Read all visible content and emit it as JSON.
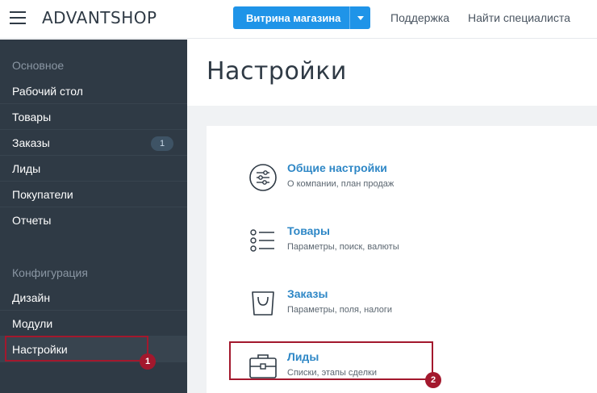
{
  "header": {
    "logo": "ADVANTSHOP",
    "store_button": "Витрина магазина",
    "links": [
      "Поддержка",
      "Найти специалиста"
    ]
  },
  "sidebar": {
    "section_main": "Основное",
    "main_items": [
      {
        "label": "Рабочий стол"
      },
      {
        "label": "Товары"
      },
      {
        "label": "Заказы",
        "badge": "1"
      },
      {
        "label": "Лиды"
      },
      {
        "label": "Покупатели"
      },
      {
        "label": "Отчеты"
      }
    ],
    "section_config": "Конфигурация",
    "config_items": [
      {
        "label": "Дизайн"
      },
      {
        "label": "Модули"
      },
      {
        "label": "Настройки"
      }
    ]
  },
  "main": {
    "title": "Настройки",
    "settings": [
      {
        "title": "Общие настройки",
        "subtitle": "О компании, план продаж",
        "icon": "sliders-icon"
      },
      {
        "title": "Товары",
        "subtitle": "Параметры, поиск, валюты",
        "icon": "list-icon"
      },
      {
        "title": "Заказы",
        "subtitle": "Параметры, поля, налоги",
        "icon": "shopping-bag-icon"
      },
      {
        "title": "Лиды",
        "subtitle": "Списки, этапы сделки",
        "icon": "briefcase-icon"
      }
    ]
  },
  "annotations": [
    {
      "number": "1",
      "target": "Настройки"
    },
    {
      "number": "2",
      "target": "Лиды"
    }
  ],
  "colors": {
    "sidebar_bg": "#2f3a45",
    "accent": "#1f94e8",
    "link": "#2e87c6",
    "highlight": "#a3182d"
  }
}
